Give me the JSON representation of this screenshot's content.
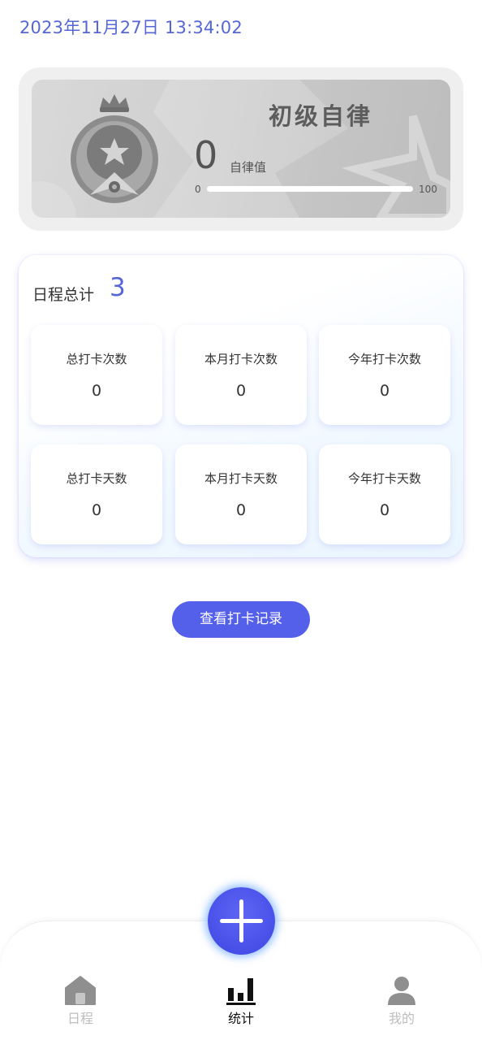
{
  "header": {
    "datetime": "2023年11月27日 13:34:02"
  },
  "level_card": {
    "title": "初级自律",
    "value": "0",
    "value_label": "自律值",
    "range_min": "0",
    "range_max": "100",
    "progress_fraction": 0.0,
    "badge_icon": "medal-star-icon"
  },
  "stats": {
    "title": "日程总计",
    "total": "3",
    "tiles": [
      {
        "label": "总打卡次数",
        "value": "0"
      },
      {
        "label": "本月打卡次数",
        "value": "0"
      },
      {
        "label": "今年打卡次数",
        "value": "0"
      },
      {
        "label": "总打卡天数",
        "value": "0"
      },
      {
        "label": "本月打卡天数",
        "value": "0"
      },
      {
        "label": "今年打卡天数",
        "value": "0"
      }
    ]
  },
  "record_button": {
    "label": "查看打卡记录"
  },
  "bottom_nav": {
    "items": [
      {
        "label": "日程",
        "icon": "home-icon",
        "active": false
      },
      {
        "label": "统计",
        "icon": "bar-chart-icon",
        "active": true
      },
      {
        "label": "我的",
        "icon": "user-icon",
        "active": false
      }
    ],
    "add_icon": "plus-icon"
  },
  "colors": {
    "accent": "#5560ea",
    "datetime": "#5567d6",
    "nav_active": "#111111",
    "nav_inactive": "#bdbdbd"
  }
}
